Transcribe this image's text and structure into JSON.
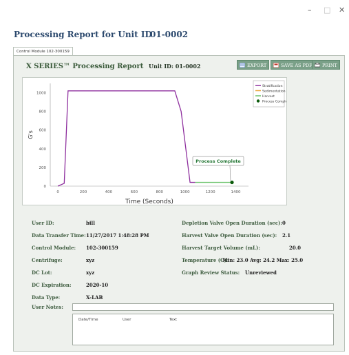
{
  "window": {
    "minimize": "–",
    "maximize": "□",
    "close": "✕"
  },
  "header": {
    "title": "Processing Report for Unit ID",
    "unit_id": "01-0002"
  },
  "tab": {
    "label": "Control Module 102-300159"
  },
  "report": {
    "title": "X SERIES™ Processing Report",
    "unit_label": "Unit ID:",
    "unit_value": "01-0002",
    "buttons": {
      "export": "EXPORT",
      "save_pdf": "SAVE AS PDF",
      "print": "PRINT"
    }
  },
  "chart_data": {
    "type": "line",
    "xlabel": "Time (Seconds)",
    "ylabel": "G's",
    "xlim": [
      -60,
      1500
    ],
    "ylim": [
      0,
      1100
    ],
    "xticks": [
      0,
      200,
      400,
      600,
      800,
      1000,
      1200,
      1400
    ],
    "yticks": [
      0,
      200,
      400,
      600,
      800,
      1000
    ],
    "series": [
      {
        "name": "Stratification",
        "color": "#8e2f9e",
        "points": [
          [
            0,
            0
          ],
          [
            50,
            30
          ],
          [
            80,
            1020
          ],
          [
            920,
            1020
          ],
          [
            970,
            800
          ],
          [
            1040,
            40
          ],
          [
            1080,
            40
          ]
        ]
      },
      {
        "name": "Sedimentation",
        "color": "#e8a43a",
        "points": []
      },
      {
        "name": "Harvest",
        "color": "#6ac26a",
        "points": [
          [
            1080,
            40
          ],
          [
            1370,
            40
          ]
        ]
      }
    ],
    "markers": [
      {
        "name": "Process Complete",
        "x": 1370,
        "y": 40,
        "color": "#0a5a0a"
      }
    ],
    "annotation": {
      "text": "Process Complete",
      "x": 1370,
      "y": 40
    },
    "legend_position": "top-right",
    "grid": false
  },
  "details": {
    "left": [
      {
        "label": "User ID:",
        "value": "bill"
      },
      {
        "label": "Data Transfer Time:",
        "value": "11/27/2017 1:48:28 PM"
      },
      {
        "label": "Control Module:",
        "value": "102-300159"
      },
      {
        "label": "Centrifuge:",
        "value": "xyz"
      },
      {
        "label": "DC Lot:",
        "value": "xyz"
      },
      {
        "label": "DC Expiration:",
        "value": "2020-10"
      },
      {
        "label": "Data Type:",
        "value": "X-LAB"
      }
    ],
    "right": [
      {
        "label": "Depletion Valve Open Duration (sec):",
        "value": "0"
      },
      {
        "label": "Harvest Valve Open Duration (sec):",
        "value": "2.1"
      },
      {
        "label": "Harvest Target Volume (mL):",
        "value": "20.0"
      },
      {
        "label": "Temperature (C):",
        "value": "Min: 23.0 Avg: 24.2 Max: 25.0"
      },
      {
        "label": "Graph Review Status:",
        "value": "Unreviewed"
      }
    ],
    "notes_label": "User Notes:",
    "notes_value": "",
    "notes_columns": [
      "Date/Time",
      "User",
      "Text"
    ]
  },
  "colors": {
    "accent": "#7aa088",
    "label": "#3f5d40",
    "title": "#2d4a6e"
  }
}
